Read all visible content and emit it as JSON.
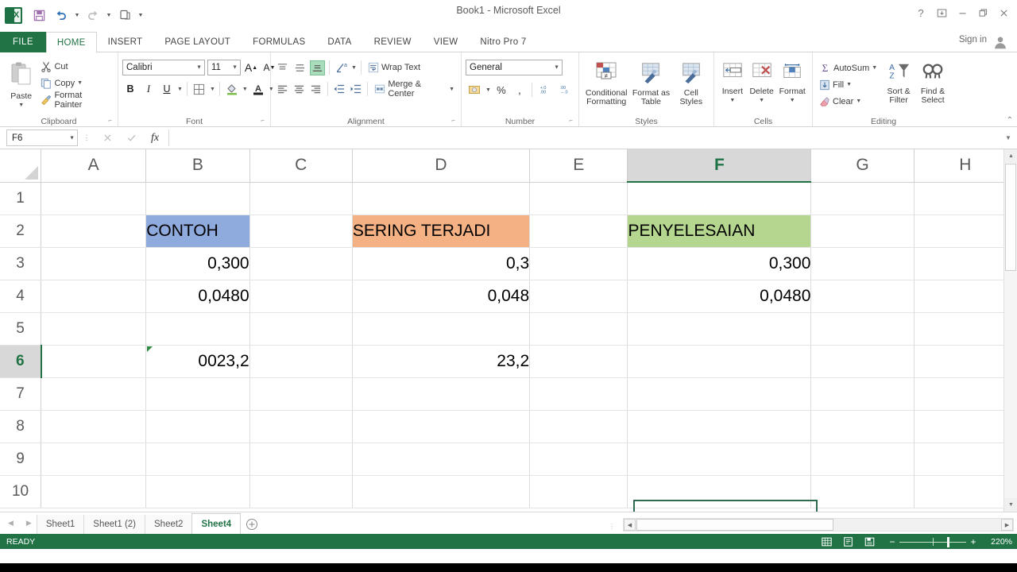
{
  "window": {
    "title": "Book1 - Microsoft Excel",
    "help_icon": "?",
    "ribbon_display_icon": "ribbon-display-options-icon",
    "minimize_icon": "minimize-icon",
    "restore_icon": "restore-icon",
    "close_icon": "close-icon",
    "sign_in": "Sign in"
  },
  "qat": {
    "logo_text": "X",
    "save": "save-icon",
    "undo": "undo-icon",
    "redo": "redo-icon",
    "touch": "touch-mode-icon",
    "customize": "customize-qat-icon"
  },
  "tabs": [
    {
      "label": "FILE",
      "active": false,
      "file": true
    },
    {
      "label": "HOME",
      "active": true
    },
    {
      "label": "INSERT",
      "active": false
    },
    {
      "label": "PAGE LAYOUT",
      "active": false
    },
    {
      "label": "FORMULAS",
      "active": false
    },
    {
      "label": "DATA",
      "active": false
    },
    {
      "label": "REVIEW",
      "active": false
    },
    {
      "label": "VIEW",
      "active": false
    },
    {
      "label": "Nitro Pro 7",
      "active": false
    }
  ],
  "ribbon": {
    "clipboard": {
      "label": "Clipboard",
      "paste": "Paste",
      "cut": "Cut",
      "copy": "Copy",
      "format_painter": "Format Painter"
    },
    "font": {
      "label": "Font",
      "font_name": "Calibri",
      "font_size": "11",
      "grow": "A",
      "shrink": "A",
      "bold": "B",
      "italic": "I",
      "underline": "U",
      "borders": "borders-icon",
      "fill_color": "fill-color-icon",
      "font_color": "font-color-icon"
    },
    "alignment": {
      "label": "Alignment",
      "align_top": "align-top-icon",
      "align_middle": "align-middle-icon",
      "align_bottom": "align-bottom-icon",
      "orientation": "orientation-icon",
      "wrap_text": "Wrap Text",
      "align_left": "align-left-icon",
      "align_center": "align-center-icon",
      "align_right": "align-right-icon",
      "decrease_indent": "decrease-indent-icon",
      "increase_indent": "increase-indent-icon",
      "merge_center": "Merge & Center"
    },
    "number": {
      "label": "Number",
      "format": "General",
      "accounting": "accounting-format-icon",
      "percent": "%",
      "comma": ",",
      "increase_decimal": "increase-decimal-icon",
      "decrease_decimal": "decrease-decimal-icon"
    },
    "styles": {
      "label": "Styles",
      "conditional_formatting": "Conditional\nFormatting",
      "conditional_formatting_l1": "Conditional",
      "conditional_formatting_l2": "Formatting",
      "format_as_table_l1": "Format as",
      "format_as_table_l2": "Table",
      "cell_styles_l1": "Cell",
      "cell_styles_l2": "Styles"
    },
    "cells": {
      "label": "Cells",
      "insert": "Insert",
      "delete": "Delete",
      "format": "Format"
    },
    "editing": {
      "label": "Editing",
      "autosum": "AutoSum",
      "fill": "Fill",
      "clear": "Clear",
      "sort_filter_l1": "Sort &",
      "sort_filter_l2": "Filter",
      "find_select_l1": "Find &",
      "find_select_l2": "Select"
    }
  },
  "formula_bar": {
    "name_box": "F6",
    "cancel_icon": "cancel-icon",
    "enter_icon": "confirm-icon",
    "function_icon": "fx",
    "formula_value": ""
  },
  "grid": {
    "columns": [
      "A",
      "B",
      "C",
      "D",
      "E",
      "F",
      "G",
      "H"
    ],
    "selected_column": "F",
    "selected_row": 6,
    "selected_cell": "F6",
    "rows": [
      {
        "n": "1",
        "cells": {
          "A": "",
          "B": "",
          "C": "",
          "D": "",
          "E": "",
          "F": "",
          "G": "",
          "H": ""
        }
      },
      {
        "n": "2",
        "cells": {
          "A": "",
          "B": "CONTOH",
          "C": "",
          "D": "SERING TERJADI",
          "E": "",
          "F": "PENYELESAIAN",
          "G": "",
          "H": ""
        }
      },
      {
        "n": "3",
        "cells": {
          "A": "",
          "B": "0,300",
          "C": "",
          "D": "0,3",
          "E": "",
          "F": "0,300",
          "G": "",
          "H": ""
        }
      },
      {
        "n": "4",
        "cells": {
          "A": "",
          "B": "0,0480",
          "C": "",
          "D": "0,048",
          "E": "",
          "F": "0,0480",
          "G": "",
          "H": ""
        }
      },
      {
        "n": "5",
        "cells": {
          "A": "",
          "B": "",
          "C": "",
          "D": "",
          "E": "",
          "F": "",
          "G": "",
          "H": ""
        }
      },
      {
        "n": "6",
        "cells": {
          "A": "",
          "B": "0023,2",
          "C": "",
          "D": "23,2",
          "E": "",
          "F": "",
          "G": "",
          "H": ""
        }
      },
      {
        "n": "7",
        "cells": {
          "A": "",
          "B": "",
          "C": "",
          "D": "",
          "E": "",
          "F": "",
          "G": "",
          "H": ""
        }
      },
      {
        "n": "8",
        "cells": {
          "A": "",
          "B": "",
          "C": "",
          "D": "",
          "E": "",
          "F": "",
          "G": "",
          "H": ""
        }
      },
      {
        "n": "9",
        "cells": {
          "A": "",
          "B": "",
          "C": "",
          "D": "",
          "E": "",
          "F": "",
          "G": "",
          "H": ""
        }
      },
      {
        "n": "10",
        "cells": {
          "A": "",
          "B": "",
          "C": "",
          "D": "",
          "E": "",
          "F": "",
          "G": "",
          "H": ""
        }
      }
    ],
    "colors": {
      "contoh_fill": "#8FAADC",
      "sering_terjadi_fill": "#F4B183",
      "penyelesaian_fill": "#B4D68E",
      "selection_border": "#2F6B4F",
      "header_selected_bg": "#D8D8D8",
      "header_selected_text": "#217346"
    }
  },
  "sheet_tabs": {
    "prev_icon": "previous-sheet-icon",
    "next_icon": "next-sheet-icon",
    "tabs": [
      {
        "label": "Sheet1",
        "active": false
      },
      {
        "label": "Sheet1 (2)",
        "active": false
      },
      {
        "label": "Sheet2",
        "active": false
      },
      {
        "label": "Sheet4",
        "active": true
      }
    ],
    "add_label": "+"
  },
  "status_bar": {
    "state": "READY",
    "view_normal": "normal-view-icon",
    "view_page_layout": "page-layout-view-icon",
    "view_page_break": "page-break-preview-icon",
    "zoom_out": "−",
    "zoom_in": "+",
    "zoom_level": "220%"
  }
}
